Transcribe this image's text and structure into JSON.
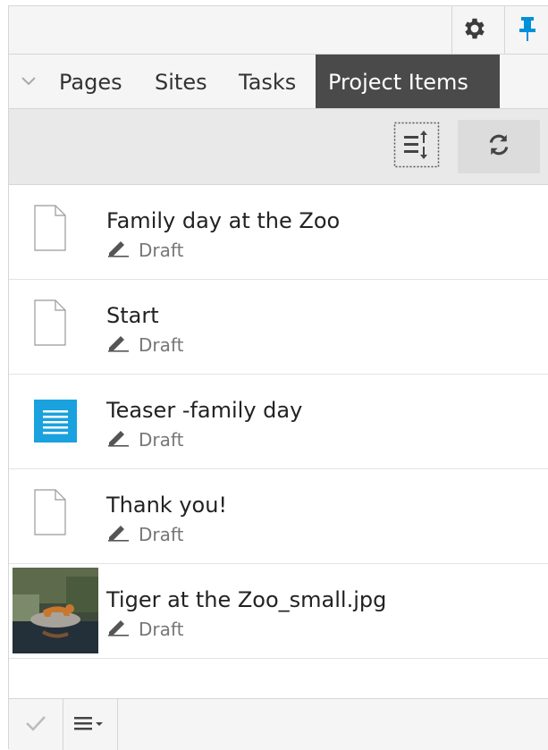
{
  "toolbar": {
    "settings_icon": "gear-icon",
    "pin_icon": "pin-icon",
    "accent": "#0090d9"
  },
  "tabs": [
    {
      "label": "Pages"
    },
    {
      "label": "Sites"
    },
    {
      "label": "Tasks"
    },
    {
      "label": "Project Items",
      "active": true
    }
  ],
  "actions": {
    "sort_icon": "sort-icon",
    "refresh_icon": "refresh-icon"
  },
  "items": [
    {
      "title": "Family day at the Zoo",
      "status": "Draft",
      "icon": "page-icon"
    },
    {
      "title": "Start",
      "status": "Draft",
      "icon": "page-icon"
    },
    {
      "title": "Teaser -family day",
      "status": "Draft",
      "icon": "block-icon"
    },
    {
      "title": "Thank you!",
      "status": "Draft",
      "icon": "page-icon"
    },
    {
      "title": "Tiger at the Zoo_small.jpg",
      "status": "Draft",
      "icon": "image-thumbnail"
    }
  ],
  "footer": {
    "check_icon": "check-icon",
    "menu_icon": "menu-icon"
  }
}
